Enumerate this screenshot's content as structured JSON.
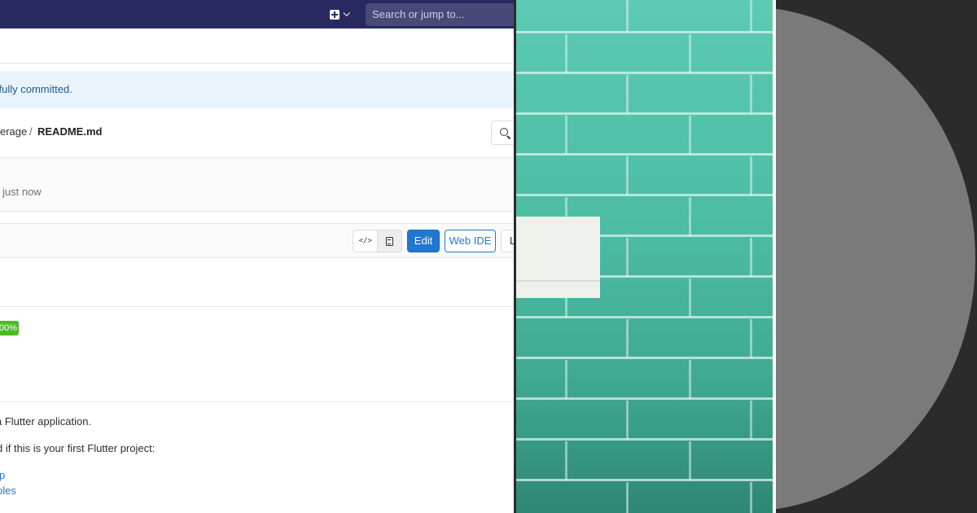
{
  "topbar": {
    "new_menu_icon": "plus-square-icon",
    "search_placeholder": "Search or jump to..."
  },
  "flash": {
    "message": "sfully committed."
  },
  "breadcrumb": {
    "parent": "erage",
    "separator": "/",
    "file": "README.md"
  },
  "commit": {
    "time": "just now"
  },
  "file_header": {
    "source_icon": "</>",
    "edit": "Edit",
    "web_ide": "Web IDE",
    "lock": "L"
  },
  "readme": {
    "badge": "00%",
    "line1": "a Flutter application.",
    "line2": "d if this is your first Flutter project:",
    "link1": "p",
    "link2": "ples"
  },
  "colors": {
    "header": "#292961",
    "accent": "#1f78d1",
    "badge": "#4cba27",
    "wall": "#4cbca3"
  }
}
